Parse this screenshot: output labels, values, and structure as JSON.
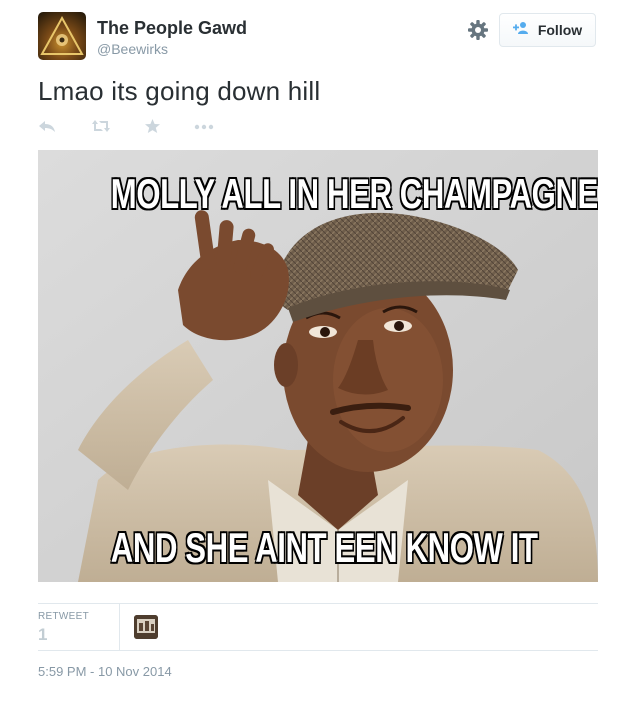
{
  "user": {
    "display_name": "The People Gawd",
    "handle": "@Beewirks"
  },
  "header": {
    "follow_label": "Follow"
  },
  "tweet": {
    "text": "Lmao its going down hill",
    "timestamp": "5:59 PM - 10 Nov 2014"
  },
  "actions": {
    "icons": [
      "reply-icon",
      "retweet-icon",
      "favorite-icon",
      "more-icon"
    ]
  },
  "media": {
    "top_caption": "MOLLY ALL IN HER CHAMPAGNE",
    "bottom_caption": "AND SHE AINT EEN KNOW IT"
  },
  "stats": {
    "retweets_label": "RETWEET",
    "retweets_count": "1"
  },
  "colors": {
    "text_primary": "#292f33",
    "text_secondary": "#8899a6",
    "follow_icon_blue": "#55acee",
    "divider": "#e1e8ed"
  }
}
